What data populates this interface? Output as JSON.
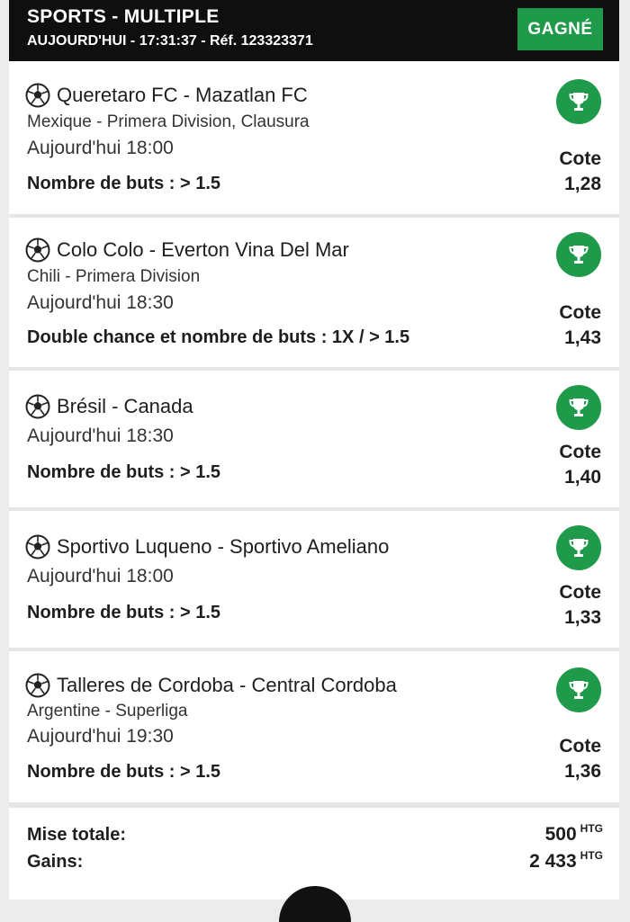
{
  "header": {
    "title": "SPORTS - MULTIPLE",
    "subtitle": "AUJOURD'HUI - 17:31:37 - Réf. 123323371",
    "status": "GAGNÉ"
  },
  "colors": {
    "win_green": "#1f9a4a",
    "header_bg": "#0f0f0f"
  },
  "icons": {
    "sport": "soccer-ball-icon",
    "result": "trophy-icon"
  },
  "cote_label": "Cote",
  "bets": [
    {
      "match": "Queretaro FC - Mazatlan FC",
      "league": "Mexique  -  Primera Division, Clausura",
      "time": "Aujourd'hui 18:00",
      "market": "Nombre de buts : > 1.5",
      "odds": "1,28"
    },
    {
      "match": "Colo Colo - Everton Vina Del Mar",
      "league": "Chili  -  Primera Division",
      "time": "Aujourd'hui 18:30",
      "market": "Double chance et nombre de buts : 1X / > 1.5",
      "odds": "1,43"
    },
    {
      "match": "Brésil - Canada",
      "league": "",
      "time": "Aujourd'hui 18:30",
      "market": "Nombre de buts : > 1.5",
      "odds": "1,40"
    },
    {
      "match": "Sportivo Luqueno - Sportivo Ameliano",
      "league": "",
      "time": "Aujourd'hui 18:00",
      "market": "Nombre de buts : > 1.5",
      "odds": "1,33"
    },
    {
      "match": "Talleres de Cordoba - Central Cordoba",
      "league": "Argentine  -  Superliga",
      "time": "Aujourd'hui 19:30",
      "market": "Nombre de buts : > 1.5",
      "odds": "1,36"
    }
  ],
  "summary": {
    "stake_label": "Mise totale:",
    "stake_value": "500",
    "winnings_label": "Gains:",
    "winnings_value": "2 433",
    "currency": "HTG"
  }
}
